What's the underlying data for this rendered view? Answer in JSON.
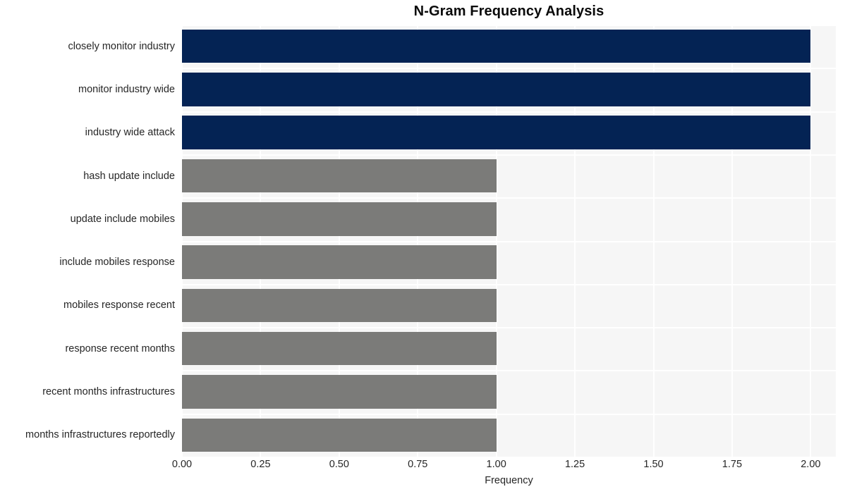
{
  "chart_data": {
    "type": "bar",
    "orientation": "horizontal",
    "title": "N-Gram Frequency Analysis",
    "xlabel": "Frequency",
    "ylabel": "",
    "categories": [
      "closely monitor industry",
      "monitor industry wide",
      "industry wide attack",
      "hash update include",
      "update include mobiles",
      "include mobiles response",
      "mobiles response recent",
      "response recent months",
      "recent months infrastructures",
      "months infrastructures reportedly"
    ],
    "values": [
      2,
      2,
      2,
      1,
      1,
      1,
      1,
      1,
      1,
      1
    ],
    "bar_colors": [
      "#042354",
      "#042354",
      "#042354",
      "#7b7b79",
      "#7b7b79",
      "#7b7b79",
      "#7b7b79",
      "#7b7b79",
      "#7b7b79",
      "#7b7b79"
    ],
    "xlim": [
      0,
      2.08
    ],
    "xticks": [
      0,
      0.25,
      0.5,
      0.75,
      1,
      1.25,
      1.5,
      1.75,
      2
    ],
    "xtick_labels": [
      "0.00",
      "0.25",
      "0.50",
      "0.75",
      "1.00",
      "1.25",
      "1.50",
      "1.75",
      "2.00"
    ],
    "grid": true,
    "grid_color": "#ffffff",
    "plot_background": "#f6f6f6",
    "figure_background": "#ffffff",
    "legend": null
  },
  "style": {
    "accent_high": "#042354",
    "accent_low": "#7b7b79",
    "text_color": "#262626",
    "title_color": "#0a0a0a"
  }
}
